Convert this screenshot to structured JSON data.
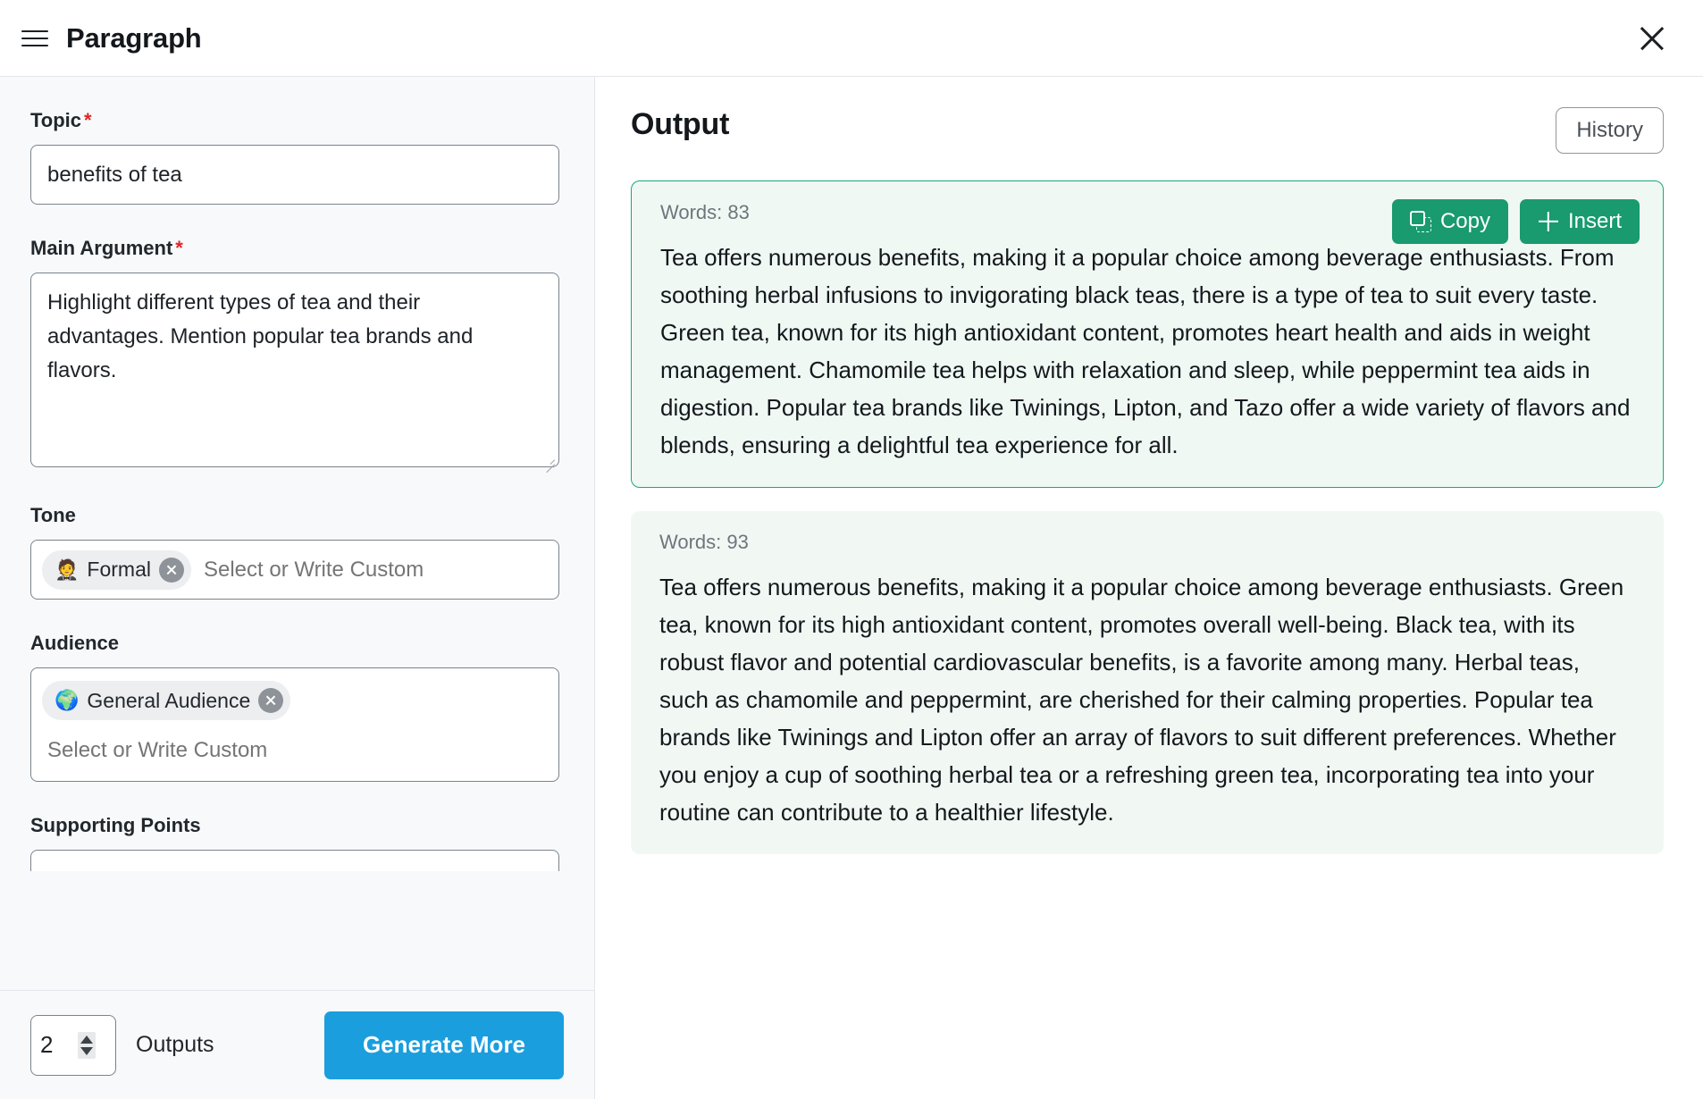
{
  "header": {
    "menu_icon": "hamburger-icon",
    "title": "Paragraph",
    "close_icon": "close-icon"
  },
  "form": {
    "topic": {
      "label": "Topic",
      "required_marker": "*",
      "value": "benefits of tea"
    },
    "main_argument": {
      "label": "Main Argument",
      "required_marker": "*",
      "value": "Highlight different types of tea and their advantages. Mention popular tea brands and flavors."
    },
    "tone": {
      "label": "Tone",
      "chip_emoji": "🤵",
      "chip_label": "Formal",
      "placeholder": "Select or Write Custom"
    },
    "audience": {
      "label": "Audience",
      "chip_emoji": "🌍",
      "chip_label": "General Audience",
      "placeholder": "Select or Write Custom"
    },
    "supporting_points": {
      "label": "Supporting Points"
    }
  },
  "bottom_bar": {
    "outputs_count": "2",
    "outputs_label": "Outputs",
    "generate_label": "Generate More"
  },
  "output": {
    "title": "Output",
    "history_label": "History",
    "copy_label": "Copy",
    "insert_label": "Insert",
    "cards": [
      {
        "words_label": "Words: 83",
        "text": "Tea offers numerous benefits, making it a popular choice among beverage enthusiasts. From soothing herbal infusions to invigorating black teas, there is a type of tea to suit every taste. Green tea, known for its high antioxidant content, promotes heart health and aids in weight management. Chamomile tea helps with relaxation and sleep, while peppermint tea aids in digestion. Popular tea brands like Twinings, Lipton, and Tazo offer a wide variety of flavors and blends, ensuring a delightful tea experience for all."
      },
      {
        "words_label": "Words: 93",
        "text": "Tea offers numerous benefits, making it a popular choice among beverage enthusiasts. Green tea, known for its high antioxidant content, promotes overall well-being. Black tea, with its robust flavor and potential cardiovascular benefits, is a favorite among many. Herbal teas, such as chamomile and peppermint, are cherished for their calming properties. Popular tea brands like Twinings and Lipton offer an array of flavors to suit different preferences. Whether you enjoy a cup of soothing herbal tea or a refreshing green tea, incorporating tea into your routine can contribute to a healthier lifestyle."
      }
    ]
  },
  "colors": {
    "accent_blue": "#1a9ede",
    "accent_green": "#199a6f",
    "card_border_green": "#17a97c",
    "required_red": "#e02424"
  }
}
